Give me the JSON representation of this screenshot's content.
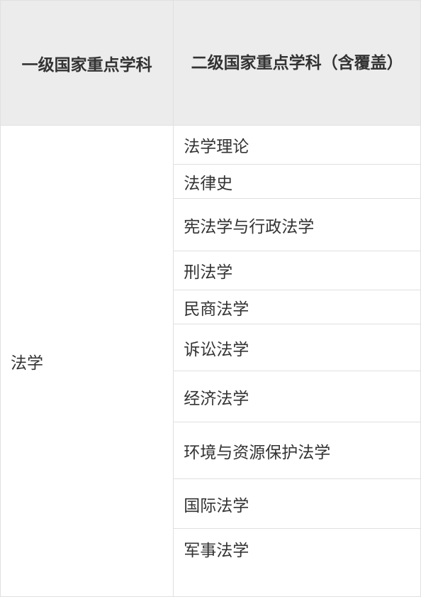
{
  "table": {
    "headers": {
      "col1": "一级国家重点学科",
      "col2": "二级国家重点学科（含覆盖）"
    },
    "body": {
      "primary": "法学",
      "secondary": [
        "法学理论",
        "法律史",
        "宪法学与行政法学",
        "刑法学",
        "民商法学",
        "诉讼法学",
        "经济法学",
        "环境与资源保护法学",
        "国际法学",
        "军事法学"
      ]
    }
  }
}
